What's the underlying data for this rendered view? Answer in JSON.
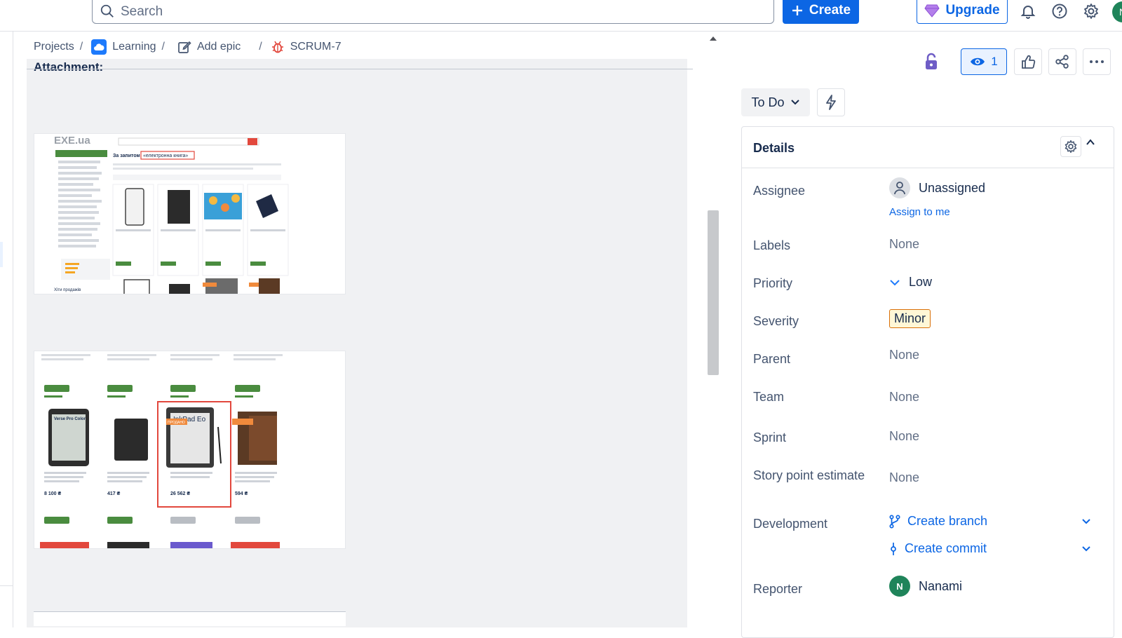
{
  "topbar": {
    "search_placeholder": "Search",
    "create_label": "Create",
    "upgrade_label": "Upgrade",
    "user_initial": "N"
  },
  "breadcrumb": {
    "projects": "Projects",
    "project": "Learning",
    "epic": "Add epic",
    "issue": "SCRUM-7"
  },
  "content": {
    "attachment_heading": "Attachment:",
    "thumb1": {
      "logo": "EXE.ua",
      "query_prefix": "За запитом",
      "query": "«електронна книга»",
      "sidebar_footer": "Хіти продажів"
    },
    "thumb2": {
      "badge": "ПРОДАНО",
      "highlighted_title": "InkPad Eo",
      "highlighted_price": "26 562 ₴",
      "product_a": "Verse Pro Color",
      "product_a_price": "8 100 ₴",
      "product_b_price": "417 ₴",
      "product_d_price": "594 ₴"
    }
  },
  "panel": {
    "watch_count": "1",
    "status": "To Do",
    "details_title": "Details",
    "fields": {
      "assignee_label": "Assignee",
      "assignee_value": "Unassigned",
      "assign_to_me": "Assign to me",
      "labels_label": "Labels",
      "labels_value": "None",
      "priority_label": "Priority",
      "priority_value": "Low",
      "severity_label": "Severity",
      "severity_value": "Minor",
      "parent_label": "Parent",
      "parent_value": "None",
      "team_label": "Team",
      "team_value": "None",
      "sprint_label": "Sprint",
      "sprint_value": "None",
      "story_label": "Story point estimate",
      "story_value": "None",
      "development_label": "Development",
      "create_branch": "Create branch",
      "create_commit": "Create commit",
      "reporter_label": "Reporter",
      "reporter_initial": "N",
      "reporter_name": "Nanami"
    }
  },
  "colors": {
    "primary": "#0c66e4",
    "severity_border": "#d97008",
    "avatar_green": "#1f845a",
    "lock_purple": "#6e5dc6"
  }
}
